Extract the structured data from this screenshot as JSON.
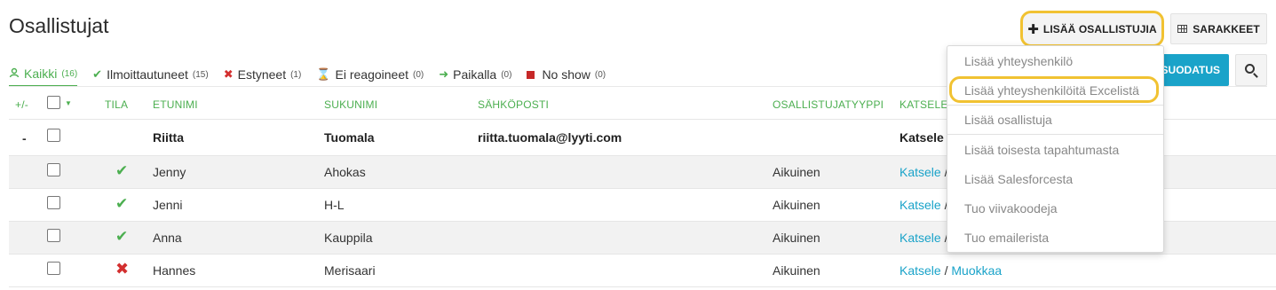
{
  "page": {
    "title": "Osallistujat"
  },
  "toolbar": {
    "add_label": "LISÄÄ OSALLISTUJIA",
    "columns_label": "SARAKKEET",
    "filter_label": "SUODATUS"
  },
  "tabs": [
    {
      "label": "Kaikki",
      "count": "(16)",
      "icon": "people-icon"
    },
    {
      "label": "Ilmoittautuneet",
      "count": "(15)",
      "icon": "check-icon"
    },
    {
      "label": "Estyneet",
      "count": "(1)",
      "icon": "cross-icon"
    },
    {
      "label": "Ei reagoineet",
      "count": "(0)",
      "icon": "hourglass-icon"
    },
    {
      "label": "Paikalla",
      "count": "(0)",
      "icon": "arrow-right-icon"
    },
    {
      "label": "No show",
      "count": "(0)",
      "icon": "stop-square-icon"
    }
  ],
  "table": {
    "headers": {
      "toggle": "+/-",
      "status": "TILA",
      "first_name": "ETUNIMI",
      "last_name": "SUKUNIMI",
      "email": "SÄHKÖPOSTI",
      "type": "OSALLISTUJATYYPPI",
      "view": "KATSELE"
    },
    "contact": {
      "toggle": "-",
      "first_name": "Riitta",
      "last_name": "Tuomala",
      "email": "riitta.tuomala@lyyti.com",
      "view": "Katsele"
    },
    "rows": [
      {
        "status": "registered",
        "first_name": "Jenny",
        "last_name": "Ahokas",
        "type": "Aikuinen",
        "view": "Katsele",
        "sep": "/"
      },
      {
        "status": "registered",
        "first_name": "Jenni",
        "last_name": "H-L",
        "type": "Aikuinen",
        "view": "Katsele",
        "sep": "/"
      },
      {
        "status": "registered",
        "first_name": "Anna",
        "last_name": "Kauppila",
        "type": "Aikuinen",
        "view": "Katsele",
        "sep": "/"
      },
      {
        "status": "cancelled",
        "first_name": "Hannes",
        "last_name": "Merisaari",
        "type": "Aikuinen",
        "view": "Katsele",
        "sep": "/",
        "edit": "Muokkaa"
      }
    ]
  },
  "dropdown": {
    "items": [
      "Lisää yhteyshenkilö",
      "Lisää yhteyshenkilöitä Excelistä",
      "Lisää osallistuja",
      "Lisää toisesta tapahtumasta",
      "Lisää Salesforcesta",
      "Tuo viivakoodeja",
      "Tuo emailerista"
    ],
    "highlighted_index": 1
  },
  "colors": {
    "accent_green": "#4caf50",
    "link_blue": "#1aa3c9",
    "error_red": "#d32f2f",
    "highlight_yellow": "#f1c232"
  }
}
